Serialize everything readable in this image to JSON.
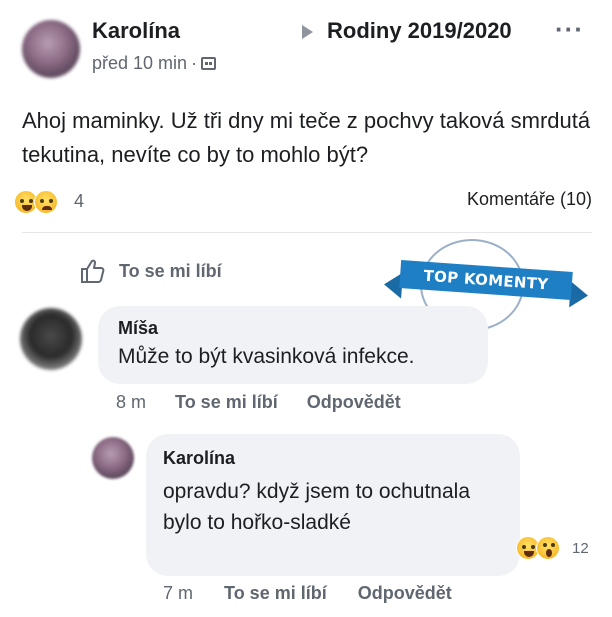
{
  "post": {
    "author": "Karolína",
    "group": "Rodiny 2019/2020",
    "time": "před 10 min",
    "text": "Ahoj maminky. Už tři dny mi teče z pochvy taková smrdutá tekutina, nevíte co by to mohlo být?",
    "reaction_count": "4",
    "comments_label": "Komentáře (10)",
    "like_label": "To se mi líbí",
    "more_label": "···",
    "reaction_icons": [
      "haha-icon",
      "sad-icon"
    ]
  },
  "badge": {
    "label": "TOP KOMENTY",
    "color": "#1f7fc4"
  },
  "comments": [
    {
      "author": "Míša",
      "text": "Může to být kvasinková infekce.",
      "time": "8 m",
      "like": "To se mi líbí",
      "reply": "Odpovědět"
    },
    {
      "author": "Karolína",
      "text": "opravdu? když jsem to ochutnala bylo to hořko-sladké",
      "time": "7 m",
      "like": "To se mi líbí",
      "reply": "Odpovědět",
      "reaction_count": "12",
      "reaction_icons": [
        "haha-icon",
        "wow-icon"
      ]
    }
  ]
}
